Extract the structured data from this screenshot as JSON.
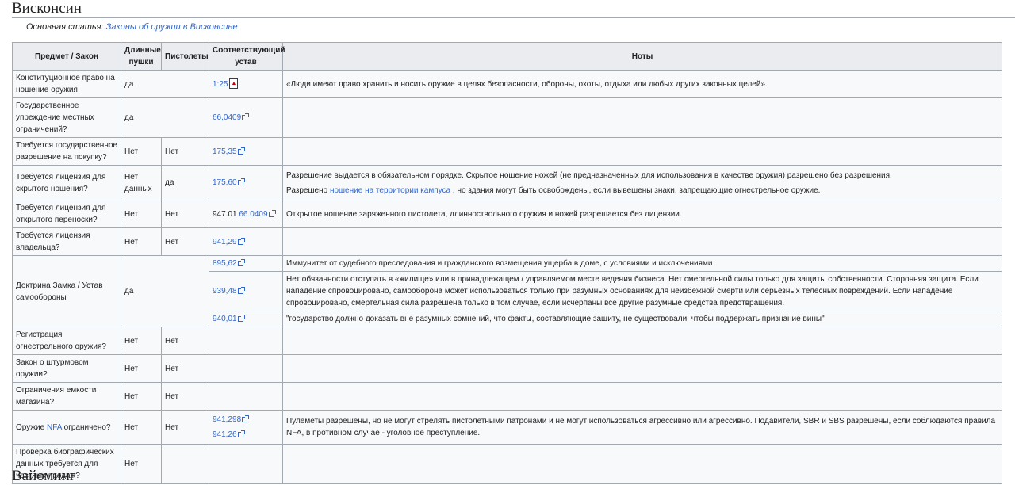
{
  "section_title": "Висконсин",
  "hatnote": {
    "prefix": "Основная статья:",
    "link": "Законы об оружии в Висконсине"
  },
  "headers": [
    "Предмет / Закон",
    "Длинные пушки",
    "Пистолеты",
    "Соответствующий устав",
    "Ноты"
  ],
  "rows": [
    {
      "subject": "Конституционное право на ношение оружия",
      "long": "да",
      "statute": "1:25",
      "notes": "«Люди имеют право хранить и носить оружие в целях безопасности, обороны, охоты, отдыха или любых других законных целей»."
    },
    {
      "subject": "Государственное упреждение местных ограничений?",
      "long": "да",
      "statute": "66,0409"
    },
    {
      "subject": "Требуется государственное разрешение на покупку?",
      "long": "Нет",
      "hand": "Нет",
      "statute": "175,35"
    },
    {
      "subject": "Требуется лицензия для скрытого ношения?",
      "long": "Нет данных",
      "hand": "да",
      "statute": "175,60",
      "notes": "Разрешение выдается в обязательном порядке. Скрытое ношение ножей (не предназначенных для использования в качестве оружия) разрешено без разрешения.",
      "notes2_pre": "Разрешено",
      "notes2_link": "ношение на территории кампуса",
      "notes2_post": ", но здания могут быть освобождены, если вывешены знаки, запрещающие огнестрельное оружие."
    },
    {
      "subject": "Требуется лицензия для открытого переноски?",
      "long": "Нет",
      "hand": "Нет",
      "statute_plain": "947.01",
      "statute": "66.0409",
      "notes": "Открытое ношение заряженного пистолета, длинноствольного оружия и ножей разрешается без лицензии."
    },
    {
      "subject": "Требуется лицензия владельца?",
      "long": "Нет",
      "hand": "Нет",
      "statute": "941,29"
    },
    {
      "subject": "Доктрина Замка / Устав самообороны",
      "long": "да",
      "sub": [
        {
          "statute": "895,62",
          "notes": "Иммунитет от судебного преследования и гражданского возмещения ущерба в доме, с условиями и исключениями"
        },
        {
          "statute": "939,48",
          "notes": "Нет обязанности отступать в «жилище» или в принадлежащем / управляемом месте ведения бизнеса. Нет смертельной силы только для защиты собственности. Сторонняя защита. Если нападение спровоцировано, самооборона может использоваться только при разумных основаниях для неизбежной смерти или серьезных телесных повреждений. Если нападение спровоцировано, смертельная сила разрешена только в том случае, если исчерпаны все другие разумные средства предотвращения."
        },
        {
          "statute": "940,01",
          "notes": "\"государство должно доказать вне разумных сомнений, что факты, составляющие защиту, не существовали, чтобы поддержать признание вины\""
        }
      ]
    },
    {
      "subject": "Регистрация огнестрельного оружия?",
      "long": "Нет",
      "hand": "Нет"
    },
    {
      "subject": "Закон о штурмовом оружии?",
      "long": "Нет",
      "hand": "Нет"
    },
    {
      "subject": "Ограничения емкости магазина?",
      "long": "Нет",
      "hand": "Нет"
    },
    {
      "subject_pre": "Оружие",
      "subject_link": "NFA",
      "subject_post": "ограничено?",
      "long": "Нет",
      "hand": "Нет",
      "statute": "941,298",
      "statute2": "941,26",
      "notes": "Пулеметы разрешены, но не могут стрелять пистолетными патронами и не могут использоваться агрессивно или агрессивно. Подавители, SBR и SBS разрешены, если соблюдаются правила NFA, в противном случае - уголовное преступление."
    },
    {
      "subject": "Проверка биографических данных требуется для частных продаж?",
      "long": "Нет"
    }
  ],
  "next_section": "Вайоминг"
}
